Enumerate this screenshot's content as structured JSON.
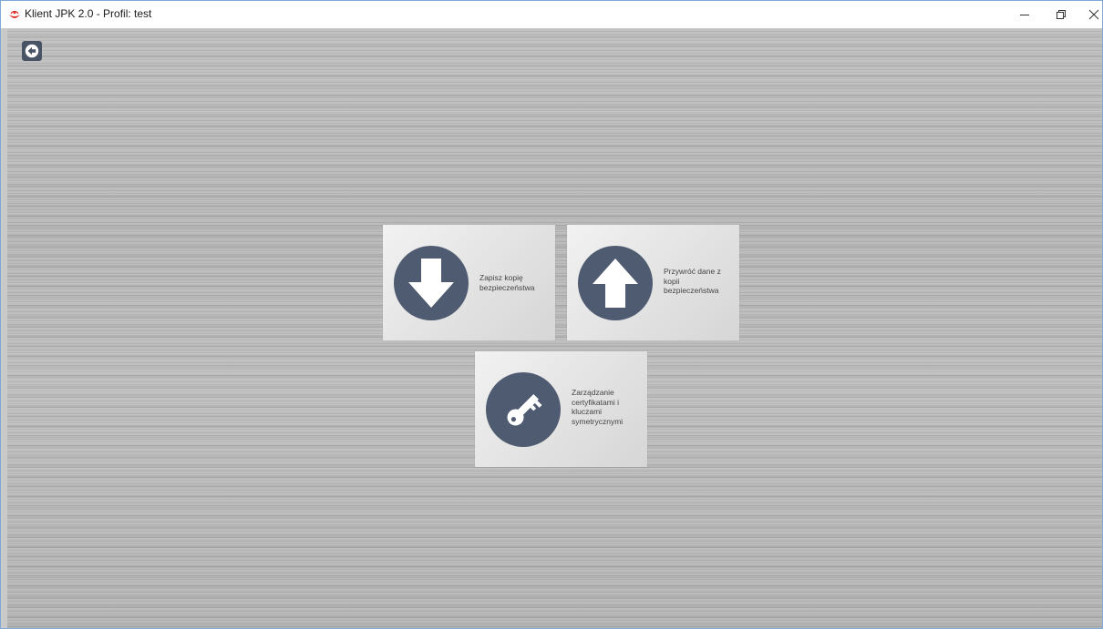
{
  "window": {
    "title": "Klient JPK 2.0 - Profil: test",
    "controls": {
      "minimize_icon": "minimize-icon",
      "maximize_icon": "restore-icon",
      "close_icon": "close-icon"
    }
  },
  "toolbar": {
    "back_icon": "back-arrow-icon"
  },
  "tiles": [
    {
      "label": "Zapisz kopię bezpieczeństwa",
      "icon": "download-arrow-icon"
    },
    {
      "label": "Przywróć dane z kopii bezpieczeństwa",
      "icon": "upload-arrow-icon"
    },
    {
      "label": "Zarządzanie certyfikatami i kluczami symetrycznymi",
      "icon": "key-icon"
    }
  ],
  "colors": {
    "icon_circle": "#4f5b70",
    "tile_background": "#e6e6e6",
    "window_border": "#7fa9d6",
    "app_icon_red": "#d9322a"
  }
}
